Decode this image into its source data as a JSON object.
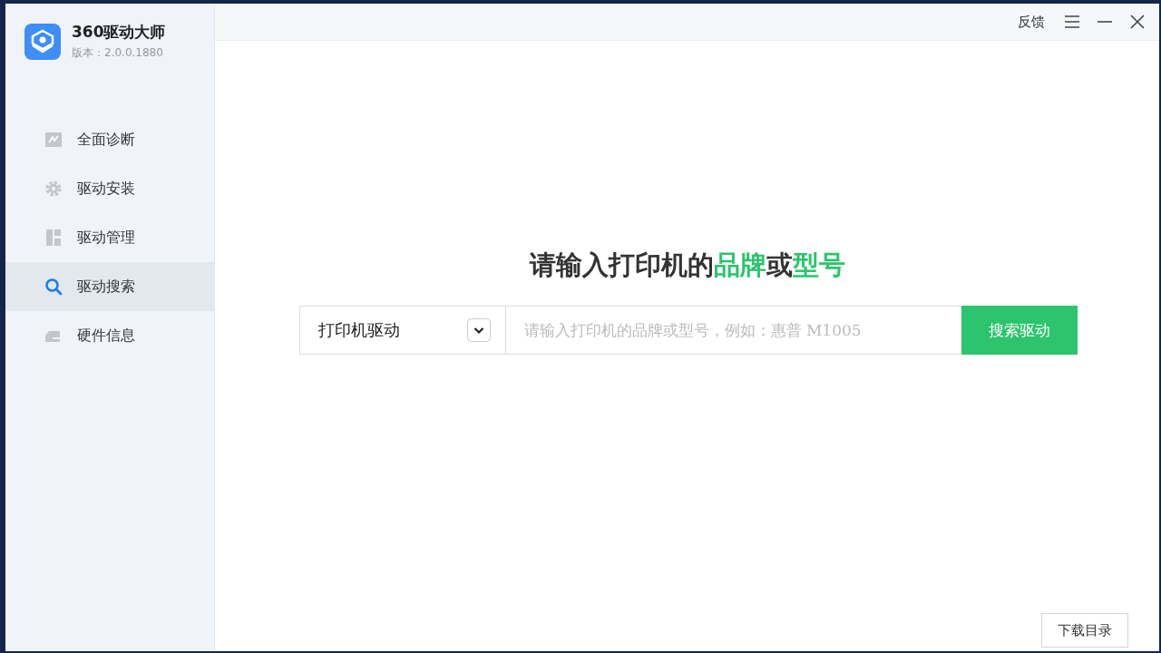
{
  "app": {
    "name": "360驱动大师",
    "version": "版本：2.0.0.1880"
  },
  "title_bar": {
    "feedback": "反馈"
  },
  "sidebar": {
    "items": [
      {
        "label": "全面诊断",
        "kind": "chart",
        "selected": false
      },
      {
        "label": "驱动安装",
        "kind": "gear",
        "selected": false
      },
      {
        "label": "驱动管理",
        "kind": "grid",
        "selected": false
      },
      {
        "label": "驱动搜索",
        "kind": "search",
        "selected": true
      },
      {
        "label": "硬件信息",
        "kind": "drive",
        "selected": false
      }
    ]
  },
  "search": {
    "heading": [
      {
        "text": "请输入打印机的",
        "accent": false
      },
      {
        "text": "品牌",
        "accent": true
      },
      {
        "text": "或",
        "accent": false
      },
      {
        "text": "型号",
        "accent": true
      }
    ],
    "category": "打印机驱动",
    "placeholder": "请输入打印机的品牌或型号，例如：惠普 M1005",
    "button": "搜索驱动"
  },
  "download_dir_button": "下载目录"
}
